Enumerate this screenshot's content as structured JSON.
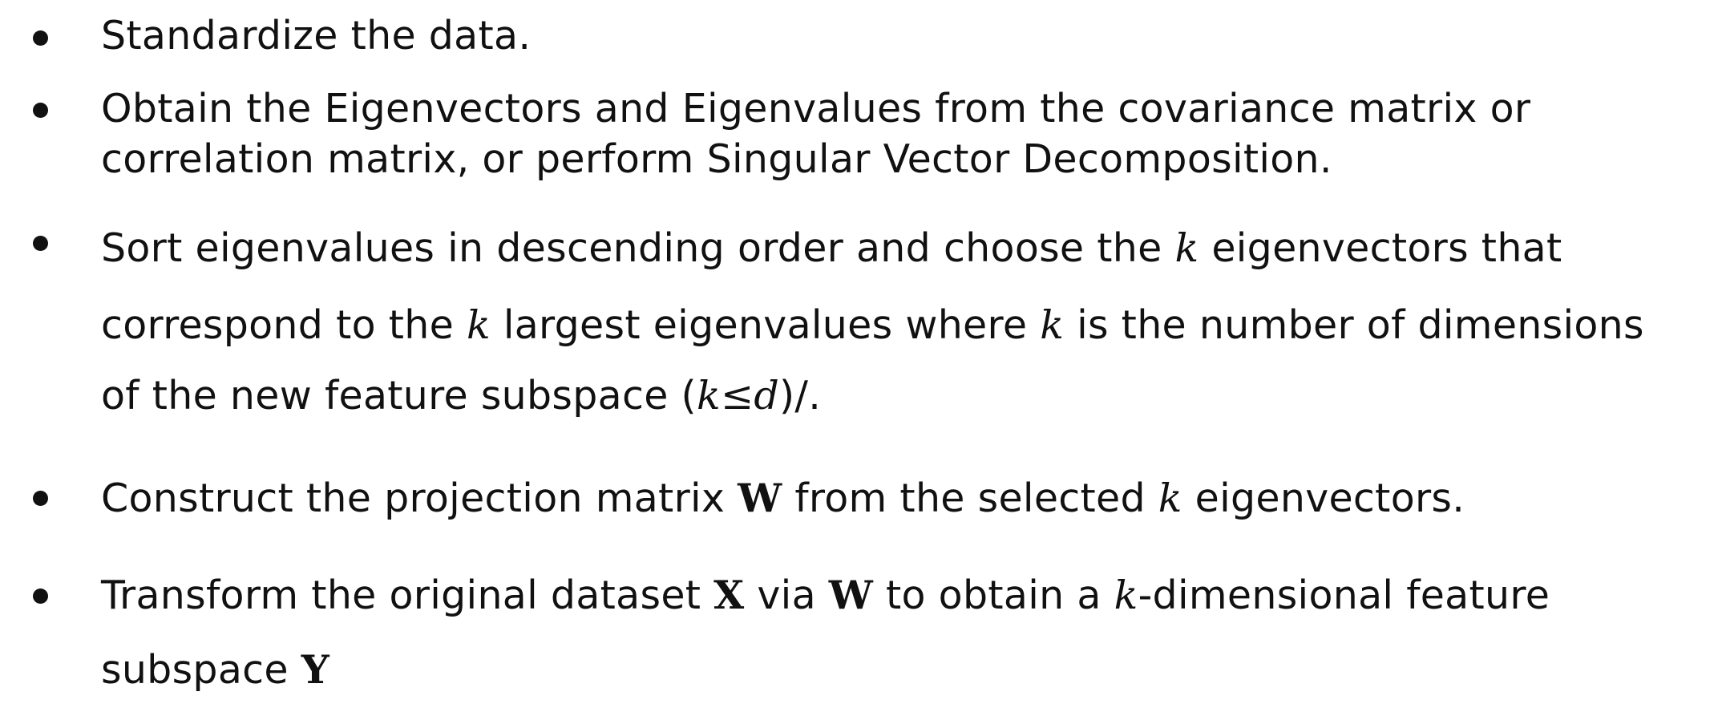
{
  "steps": [
    {
      "lines": [
        [
          "Standardize the data."
        ]
      ]
    },
    {
      "lines": [
        [
          "Obtain the Eigenvectors and Eigenvalues from the covariance matrix or"
        ],
        [
          "correlation matrix, or perform Singular Vector Decomposition."
        ]
      ]
    },
    {
      "lines": [
        [
          "Sort eigenvalues in descending order and choose the ",
          "k",
          " eigenvectors that"
        ],
        [
          "correspond to the ",
          "k",
          " largest eigenvalues where ",
          "k",
          " is the number of dimensions"
        ],
        [
          "of the new feature subspace (",
          "k≤d",
          ")/."
        ]
      ]
    },
    {
      "lines": [
        [
          "Construct the projection matrix ",
          "W",
          " from the selected ",
          "k",
          " eigenvectors."
        ]
      ]
    },
    {
      "lines": [
        [
          "Transform the original dataset ",
          "X",
          " via ",
          "W",
          " to obtain a ",
          "k",
          "-dimensional feature"
        ],
        [
          "subspace ",
          "Y"
        ]
      ]
    }
  ]
}
